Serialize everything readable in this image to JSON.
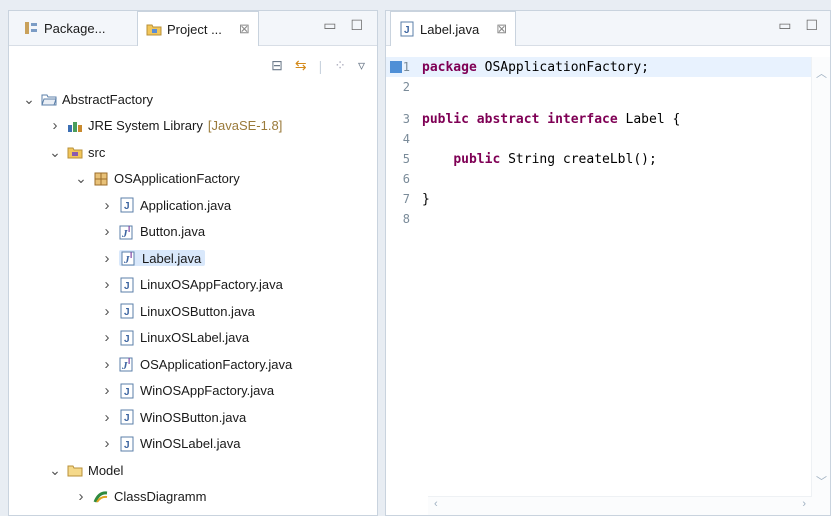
{
  "left_panel": {
    "tabs": [
      {
        "label": "Package...",
        "icon": "package-explorer-icon"
      },
      {
        "label": "Project ...",
        "icon": "project-explorer-icon",
        "active": true
      }
    ],
    "toolbar": [
      "collapse-all-icon",
      "link-editor-icon",
      "view-menu-icon",
      "chevron-down-icon"
    ],
    "tree": [
      {
        "label": "AbstractFactory",
        "depth": 0,
        "expanded": true,
        "icon": "project-folder-icon"
      },
      {
        "label": "JRE System Library",
        "decoration": "[JavaSE-1.8]",
        "depth": 1,
        "expanded": false,
        "icon": "library-icon"
      },
      {
        "label": "src",
        "depth": 1,
        "expanded": true,
        "icon": "source-folder-icon"
      },
      {
        "label": "OSApplicationFactory",
        "depth": 2,
        "expanded": true,
        "icon": "package-icon"
      },
      {
        "label": "Application.java",
        "depth": 3,
        "expanded": false,
        "icon": "java-file-icon"
      },
      {
        "label": "Button.java",
        "depth": 3,
        "expanded": false,
        "icon": "java-interface-icon"
      },
      {
        "label": "Label.java",
        "depth": 3,
        "expanded": false,
        "icon": "java-interface-icon",
        "selected": true
      },
      {
        "label": "LinuxOSAppFactory.java",
        "depth": 3,
        "expanded": false,
        "icon": "java-file-icon"
      },
      {
        "label": "LinuxOSButton.java",
        "depth": 3,
        "expanded": false,
        "icon": "java-file-icon"
      },
      {
        "label": "LinuxOSLabel.java",
        "depth": 3,
        "expanded": false,
        "icon": "java-file-icon"
      },
      {
        "label": "OSApplicationFactory.java",
        "depth": 3,
        "expanded": false,
        "icon": "java-interface-icon"
      },
      {
        "label": "WinOSAppFactory.java",
        "depth": 3,
        "expanded": false,
        "icon": "java-file-icon"
      },
      {
        "label": "WinOSButton.java",
        "depth": 3,
        "expanded": false,
        "icon": "java-file-icon"
      },
      {
        "label": "WinOSLabel.java",
        "depth": 3,
        "expanded": false,
        "icon": "java-file-icon"
      },
      {
        "label": "Model",
        "depth": 1,
        "expanded": true,
        "icon": "folder-icon"
      },
      {
        "label": "ClassDiagramm",
        "depth": 2,
        "expanded": false,
        "icon": "diagram-icon"
      }
    ]
  },
  "editor": {
    "tab": {
      "label": "Label.java",
      "icon": "java-file-icon"
    },
    "lines": [
      {
        "n": "1",
        "tokens": [
          {
            "t": "package",
            "kw": true
          },
          {
            "t": " OSApplicationFactory;"
          }
        ],
        "current": true
      },
      {
        "n": "2",
        "tokens": []
      },
      {
        "n": "3",
        "tokens": [
          {
            "t": "public",
            "kw": true
          },
          {
            "t": " "
          },
          {
            "t": "abstract",
            "kw": true
          },
          {
            "t": " "
          },
          {
            "t": "interface",
            "kw": true
          },
          {
            "t": " Label {"
          }
        ]
      },
      {
        "n": "4",
        "tokens": []
      },
      {
        "n": "5",
        "tokens": [
          {
            "t": "    "
          },
          {
            "t": "public",
            "kw": true
          },
          {
            "t": " String createLbl();"
          }
        ]
      },
      {
        "n": "6",
        "tokens": []
      },
      {
        "n": "7",
        "tokens": [
          {
            "t": "}"
          }
        ]
      },
      {
        "n": "8",
        "tokens": []
      }
    ]
  },
  "colors": {
    "keyword": "#7f0055",
    "selection": "#d9e8fb",
    "current_line": "#e8f2fe"
  }
}
